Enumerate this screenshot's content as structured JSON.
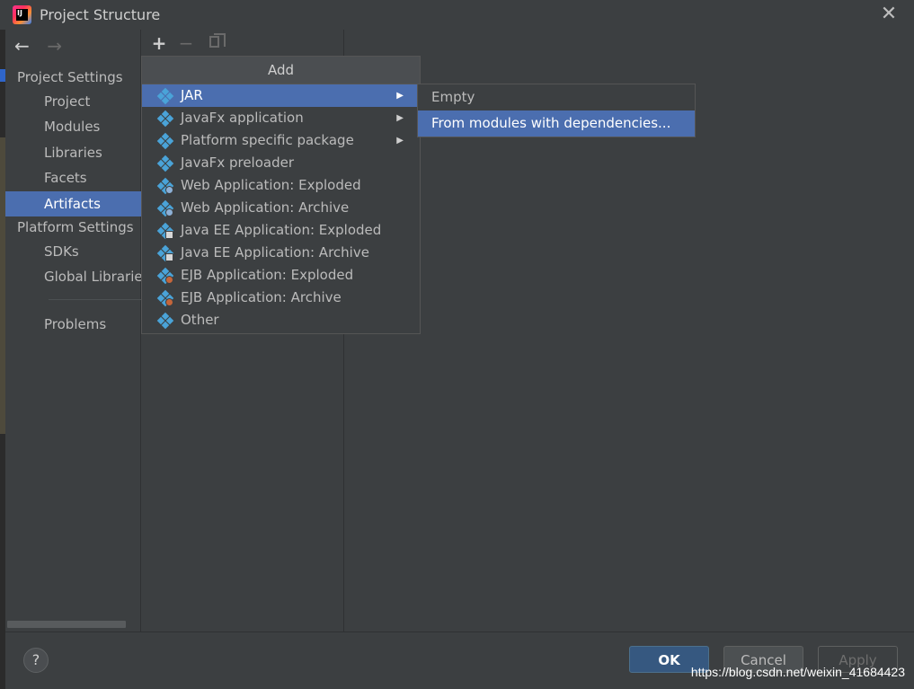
{
  "window": {
    "title": "Project Structure",
    "app_icon_text": "IJ",
    "close_glyph": "✕"
  },
  "nav": {
    "back_glyph": "←",
    "forward_glyph": "→",
    "project_settings_header": "Project Settings",
    "project_settings_items": [
      "Project",
      "Modules",
      "Libraries",
      "Facets",
      "Artifacts"
    ],
    "selected_item": "Artifacts",
    "platform_settings_header": "Platform Settings",
    "platform_settings_items": [
      "SDKs",
      "Global Libraries"
    ],
    "problems_item": "Problems"
  },
  "toolbar": {
    "add_glyph": "+",
    "remove_glyph": "−",
    "copy_icon": "copy-icon"
  },
  "add_popup": {
    "header": "Add",
    "items": [
      {
        "label": "JAR",
        "icon": "jar-icon",
        "submenu": true,
        "selected": true
      },
      {
        "label": "JavaFx application",
        "icon": "javafx-icon",
        "submenu": true
      },
      {
        "label": "Platform specific package",
        "icon": "package-icon",
        "submenu": true
      },
      {
        "label": "JavaFx preloader",
        "icon": "javafx-icon"
      },
      {
        "label": "Web Application: Exploded",
        "icon": "web-app-icon"
      },
      {
        "label": "Web Application: Archive",
        "icon": "web-app-icon"
      },
      {
        "label": "Java EE Application: Exploded",
        "icon": "javaee-app-icon"
      },
      {
        "label": "Java EE Application: Archive",
        "icon": "javaee-app-icon"
      },
      {
        "label": "EJB Application: Exploded",
        "icon": "ejb-app-icon"
      },
      {
        "label": "EJB Application: Archive",
        "icon": "ejb-app-icon"
      },
      {
        "label": "Other",
        "icon": "other-icon"
      }
    ],
    "submenu_arrow": "▶"
  },
  "jar_submenu": {
    "items": [
      "Empty",
      "From modules with dependencies..."
    ],
    "selected": "From modules with dependencies..."
  },
  "footer": {
    "help_glyph": "?",
    "ok_label": "OK",
    "cancel_label": "Cancel",
    "apply_label": "Apply",
    "watermark": "https://blog.csdn.net/weixin_41684423"
  },
  "colors": {
    "background": "#3c3f41",
    "selection": "#4b6eaf",
    "ok_button": "#365880",
    "icon_blue": "#4aa3d8"
  }
}
